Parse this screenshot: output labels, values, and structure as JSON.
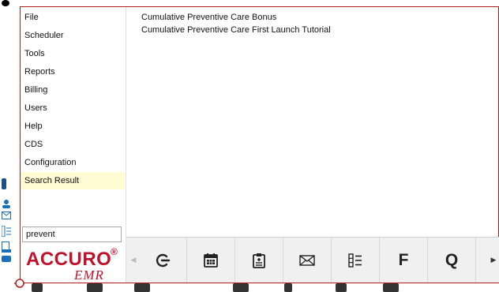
{
  "menu": {
    "items": [
      {
        "label": "File"
      },
      {
        "label": "Scheduler"
      },
      {
        "label": "Tools"
      },
      {
        "label": "Reports"
      },
      {
        "label": "Billing"
      },
      {
        "label": "Users"
      },
      {
        "label": "Help"
      },
      {
        "label": "CDS"
      },
      {
        "label": "Configuration"
      },
      {
        "label": "Search Result"
      }
    ],
    "active_item": "Search Result"
  },
  "search": {
    "value": "prevent"
  },
  "results": [
    {
      "label": "Cumulative Preventive Care Bonus"
    },
    {
      "label": "Cumulative Preventive Care First Launch Tutorial"
    }
  ],
  "logo": {
    "main": "ACCURO",
    "reg": "®",
    "sub": "EMR"
  },
  "toolbar": {
    "buttons": [
      {
        "icon": "logout-icon"
      },
      {
        "icon": "calendar-icon"
      },
      {
        "icon": "clipboard-icon"
      },
      {
        "icon": "mail-icon"
      },
      {
        "icon": "list-icon"
      },
      {
        "icon": "letter-f-icon",
        "label": "F"
      },
      {
        "icon": "letter-q-icon",
        "label": "Q"
      }
    ]
  },
  "colors": {
    "accent": "#c0122a",
    "active_bg": "#fffbd3",
    "frame": "#b71c1c",
    "toolbar_bg": "#f0f0f0"
  }
}
